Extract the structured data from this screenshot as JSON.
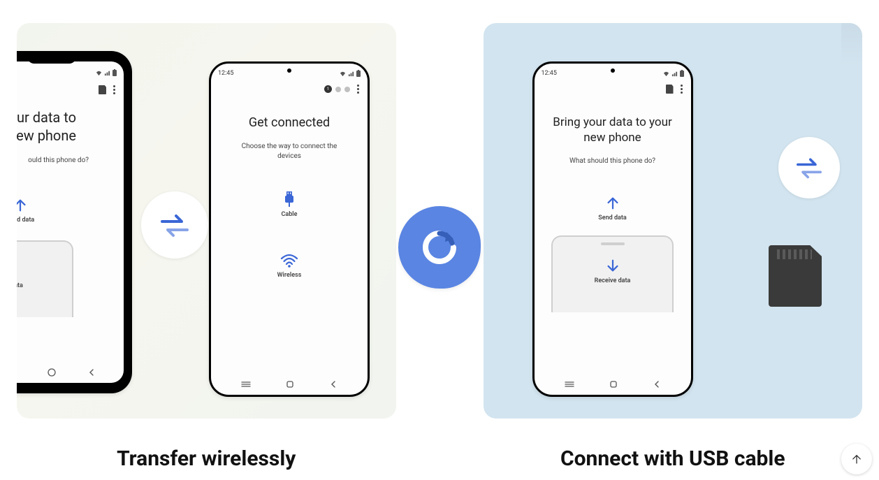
{
  "captions": {
    "left": "Transfer wirelessly",
    "right": "Connect with USB cable"
  },
  "status": {
    "time": "12:45"
  },
  "phone_a": {
    "title_line1": "your data to",
    "title_line2": "new phone",
    "subtitle_partial": "ould this phone do?",
    "send": "Send data",
    "receive": "Receive data"
  },
  "phone_b": {
    "title": "Get connected",
    "subtitle": "Choose the way to connect the devices",
    "cable": "Cable",
    "wireless": "Wireless",
    "step_active": "1"
  },
  "phone_c": {
    "title": "Bring your data to your new phone",
    "subtitle": "What should this phone do?",
    "send": "Send data",
    "receive": "Receive data"
  },
  "icons": {
    "transfer": "transfer-arrows-icon",
    "sdcard": "sd-card-icon",
    "app": "smart-switch-icon"
  }
}
